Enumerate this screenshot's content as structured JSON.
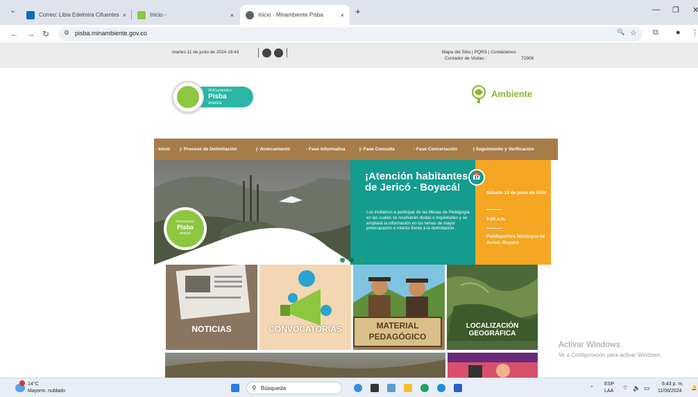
{
  "browser": {
    "tabs": [
      {
        "title": "Correo: Libia Edelmira Cifuentes",
        "close": "×",
        "favicon_color": "#0f6cbd"
      },
      {
        "title": "Inicio -",
        "close": "×",
        "favicon_color": "#8dc63f"
      },
      {
        "title": "Inicio - Minambiente Pisba",
        "close": "×",
        "favicon_color": "#5f6368"
      }
    ],
    "tab_menu": "⌄",
    "new_tab": "+",
    "controls": {
      "minimize": "—",
      "restore": "❐",
      "close": "✕"
    },
    "nav": {
      "back": "←",
      "forward": "→",
      "reload": "↻"
    },
    "url": "pisba.minambiente.gov.co",
    "icons": {
      "site_info": "⚙",
      "zoom": "🔍",
      "bookmark": "☆",
      "extensions": "⧉",
      "profile": "●",
      "menu": "⋮"
    }
  },
  "site": {
    "date": "martes 11 de junio de 2024 18:43",
    "links": "Mapa del Sitio | PQRS | Contáctenos",
    "visits_label": "Contador de Visitas :",
    "visits_count": "72908",
    "logo": {
      "small": "#ElCambioEn",
      "big": "Pisba",
      "sub": "avanza"
    },
    "ministry": "Ambiente",
    "nav": [
      "Inicio",
      "Proceso de Delimitación",
      "Acercamiento",
      "Fase Informativa",
      "Fase Consulta",
      "Fase Concertación",
      "Seguimiento y Verificación"
    ],
    "banner": {
      "title": "¡Atención habitantes de Jericó - Boyacá!",
      "body": "Los invitamos a participar de las Mesas de Pedagogía en las cuales se resolverán dudas e inquietudes y se ampliará la información en los temas de mayor preocupación e interés frente a la delimitación.",
      "day": "Sábado 15 de junio de 2024",
      "time": "9:00 a.m.",
      "place": "Polideportivo Municipio de Jericó, Boyacá",
      "calendar_icon": "📅"
    },
    "tiles": [
      {
        "label": "NOTICIAS",
        "bg": "#8a7560"
      },
      {
        "label": "CONVOCATORIAS",
        "bg": "#f3d7b3"
      },
      {
        "label": "MATERIAL PEDAGÓGICO",
        "bg": "#9a7c55"
      },
      {
        "label": "LOCALIZACIÓN GEOGRÁFICA",
        "bg": "#4d6a3a"
      }
    ]
  },
  "watermark": {
    "line1": "Activar Windows",
    "line2": "Ve a Configuración para activar Windows."
  },
  "taskbar": {
    "weather_temp": "14°C",
    "weather_desc": "Mayorm. nublado",
    "search_placeholder": "Búsqueda",
    "lang1": "ESP",
    "lang2": "LAA",
    "time": "6:43 p. m.",
    "date": "11/06/2024"
  }
}
